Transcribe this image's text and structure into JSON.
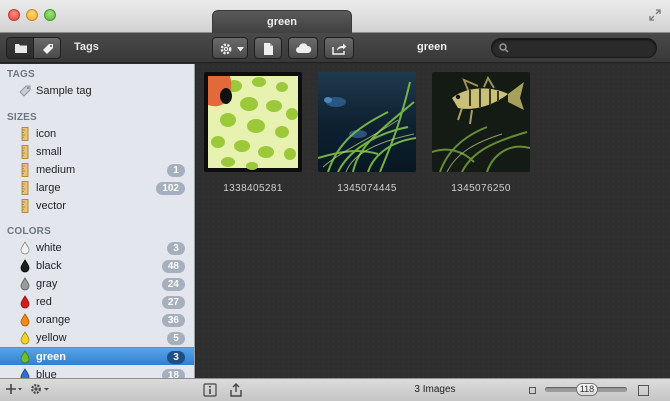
{
  "window": {
    "title": "green"
  },
  "toolbar": {
    "mode_label": "Tags",
    "title": "green",
    "search": {
      "value": "",
      "placeholder": ""
    }
  },
  "sidebar": {
    "tags_header": "TAGS",
    "tags": [
      {
        "label": "Sample tag",
        "icon": "tag-icon"
      }
    ],
    "sizes_header": "SIZES",
    "sizes": [
      {
        "label": "icon",
        "badge": ""
      },
      {
        "label": "small",
        "badge": ""
      },
      {
        "label": "medium",
        "badge": "1"
      },
      {
        "label": "large",
        "badge": "102"
      },
      {
        "label": "vector",
        "badge": ""
      }
    ],
    "colors_header": "COLORS",
    "colors": [
      {
        "label": "white",
        "badge": "3",
        "color": "#f2f2f2"
      },
      {
        "label": "black",
        "badge": "48",
        "color": "#1e1e1e"
      },
      {
        "label": "gray",
        "badge": "24",
        "color": "#9a9a9a"
      },
      {
        "label": "red",
        "badge": "27",
        "color": "#d11d1d"
      },
      {
        "label": "orange",
        "badge": "36",
        "color": "#f08a1c"
      },
      {
        "label": "yellow",
        "badge": "5",
        "color": "#f1d32b"
      },
      {
        "label": "green",
        "badge": "3",
        "color": "#6cc02b",
        "selected": true
      },
      {
        "label": "blue",
        "badge": "18",
        "color": "#2d6fd6"
      }
    ]
  },
  "images": [
    {
      "name": "1338405281"
    },
    {
      "name": "1345074445"
    },
    {
      "name": "1345076250"
    }
  ],
  "status": {
    "count_label": "3 Images",
    "zoom_value": "118"
  },
  "colors": {
    "selection": "#2f7fd3",
    "badge": "#a5afbd"
  }
}
